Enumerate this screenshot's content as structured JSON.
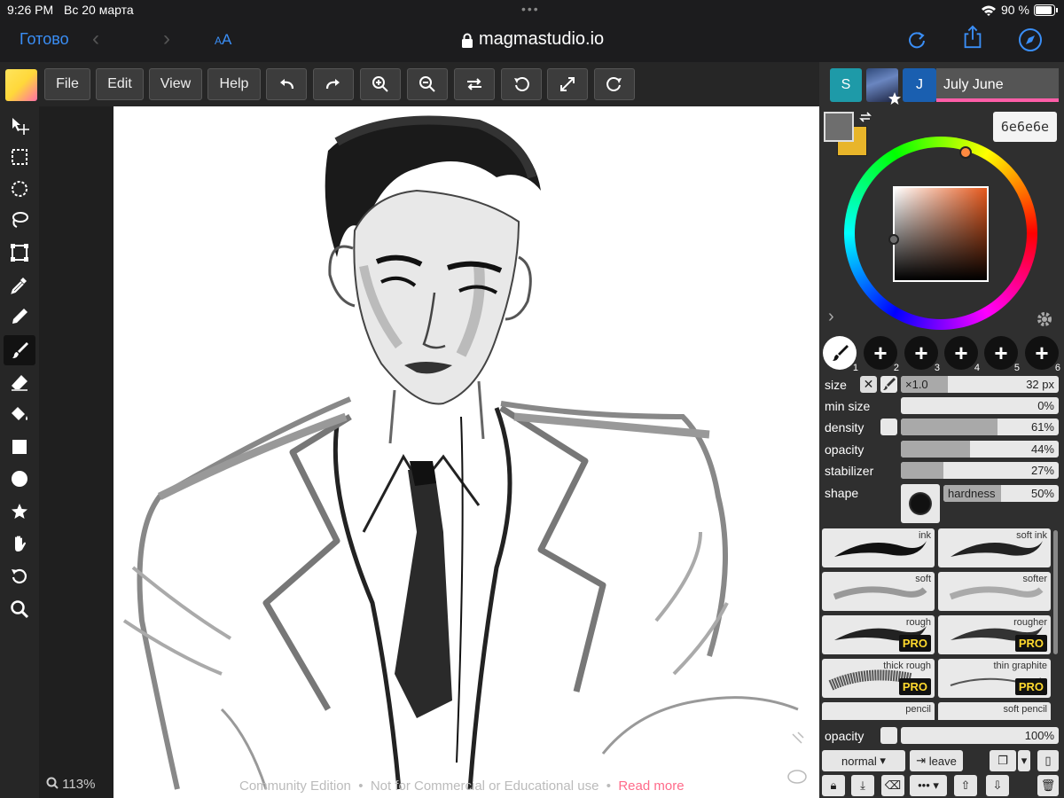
{
  "status": {
    "time": "9:26 PM",
    "date": "Вс 20 марта",
    "battery": "90 %"
  },
  "safari": {
    "done": "Готово",
    "aa_small": "A",
    "aa_large": "A",
    "url": "magmastudio.io"
  },
  "menu": {
    "file": "File",
    "edit": "Edit",
    "view": "View",
    "help": "Help"
  },
  "users": {
    "s_initial": "S",
    "j_initial": "J",
    "name": "July June"
  },
  "color": {
    "hex": "6e6e6e",
    "primary": "#6e6e6e",
    "secondary": "#e8b52a"
  },
  "brush_slots": [
    "1",
    "2",
    "3",
    "4",
    "5",
    "6"
  ],
  "brush_settings": {
    "size_label": "size",
    "size_mult": "×1.0",
    "size_value": "32 px",
    "size_fill": 0.3,
    "min_size_label": "min size",
    "min_size_value": "0%",
    "min_size_fill": 0,
    "density_label": "density",
    "density_value": "61%",
    "density_fill": 0.61,
    "opacity_label": "opacity",
    "opacity_value": "44%",
    "opacity_fill": 0.44,
    "stabilizer_label": "stabilizer",
    "stabilizer_value": "27%",
    "stabilizer_fill": 0.27,
    "shape_label": "shape",
    "hardness_label": "hardness",
    "hardness_value": "50%",
    "hardness_fill": 0.5
  },
  "brushes": [
    {
      "name": "ink",
      "pro": ""
    },
    {
      "name": "soft ink",
      "pro": ""
    },
    {
      "name": "soft",
      "pro": ""
    },
    {
      "name": "softer",
      "pro": ""
    },
    {
      "name": "rough",
      "pro": "PRO"
    },
    {
      "name": "rougher",
      "pro": "PRO"
    },
    {
      "name": "thick rough",
      "pro": "PRO"
    },
    {
      "name": "thin graphite",
      "pro": "PRO"
    },
    {
      "name": "pencil",
      "pro": ""
    },
    {
      "name": "soft pencil",
      "pro": ""
    }
  ],
  "layer": {
    "opacity_label": "opacity",
    "opacity_value": "100%",
    "blend": "normal",
    "leave": "leave"
  },
  "footer": {
    "zoom": "113%",
    "community": "Community Edition",
    "not_commercial": "Not for Commercial or Educational use",
    "read_more": "Read more"
  }
}
